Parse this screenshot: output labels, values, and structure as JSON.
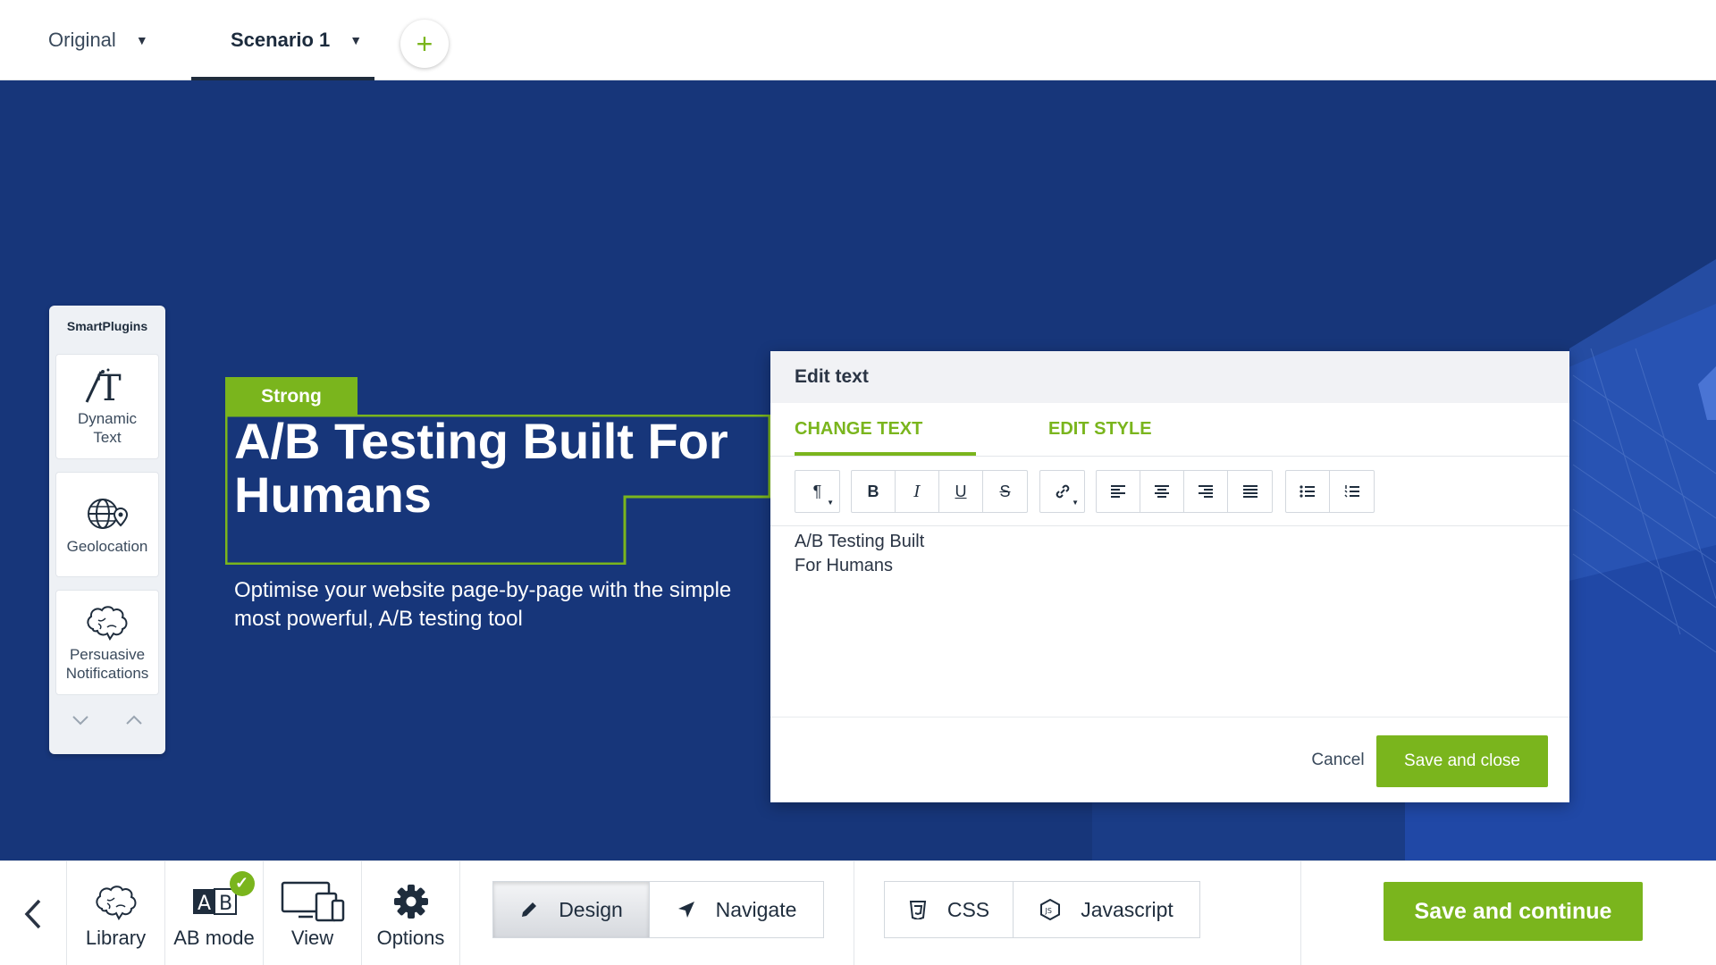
{
  "tabs": [
    {
      "label": "Original",
      "active": false
    },
    {
      "label": "Scenario 1",
      "active": true
    }
  ],
  "add_tab_icon": "plus-icon",
  "plugins": {
    "title": "SmartPlugins",
    "items": [
      {
        "label": "Dynamic Text",
        "icon": "dynamic-text-icon"
      },
      {
        "label": "Geolocation",
        "icon": "globe-pin-icon"
      },
      {
        "label": "Persuasive Notifications",
        "icon": "brain-icon"
      }
    ]
  },
  "page": {
    "tag": "Strong",
    "headline": "A/B Testing Built For Humans",
    "subline": "Optimise your website page-by-page with the simple most powerful, A/B testing tool"
  },
  "modal": {
    "title": "Edit text",
    "tabs": [
      "CHANGE TEXT",
      "EDIT STYLE"
    ],
    "active_tab": "CHANGE TEXT",
    "toolbar": {
      "paragraph": "¶",
      "bold": "B",
      "italic": "I",
      "underline": "U",
      "strike": "S"
    },
    "content": "A/B Testing Built\nFor Humans",
    "cancel": "Cancel",
    "save": "Save and close"
  },
  "bottom": {
    "library": "Library",
    "ab_mode": "AB mode",
    "view": "View",
    "options": "Options",
    "design": "Design",
    "navigate": "Navigate",
    "css": "CSS",
    "javascript": "Javascript",
    "save_continue": "Save and continue",
    "active_mode": "Design"
  },
  "colors": {
    "accent": "#7ab51d",
    "canvas": "#17367a",
    "text_dark": "#1f2d3d"
  }
}
